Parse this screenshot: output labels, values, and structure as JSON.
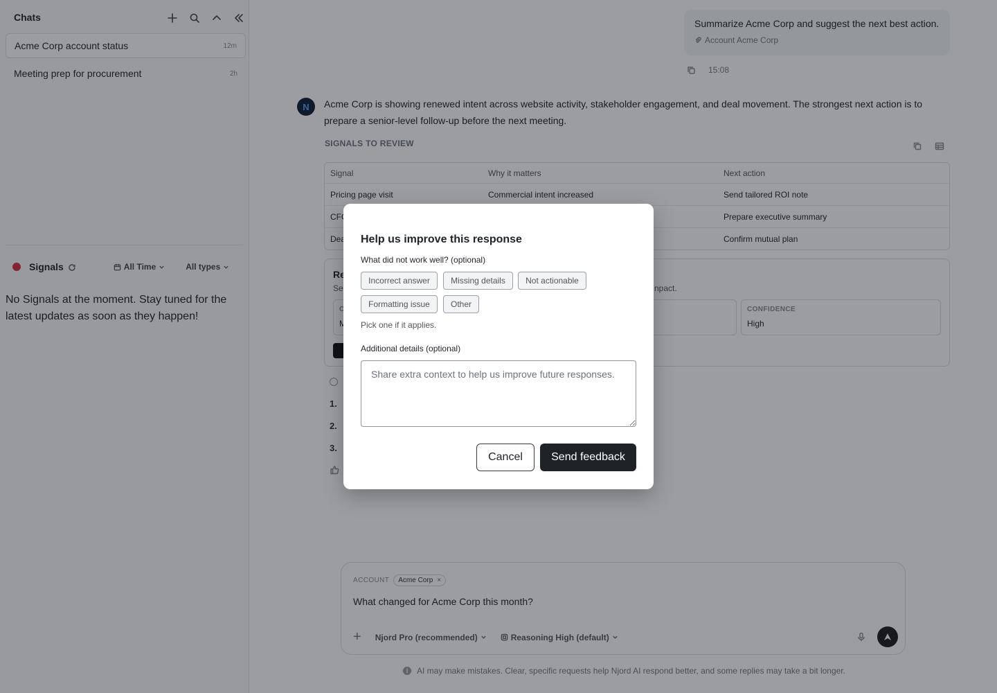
{
  "sidebar": {
    "title": "Chats",
    "chats": [
      {
        "label": "Acme Corp account status",
        "time": "12m"
      },
      {
        "label": "Meeting prep for procurement",
        "time": "2h"
      }
    ],
    "signals": {
      "title": "Signals",
      "filter_time": "All Time",
      "filter_types": "All types",
      "empty_message": "No Signals at the moment. Stay tuned for the latest updates as soon as they happen!"
    }
  },
  "conversation": {
    "user_message": "Summarize Acme Corp and suggest the next best action.",
    "user_attachment": "Account Acme Corp",
    "user_time": "15:08",
    "assistant_avatar": "N",
    "assistant_text": "Acme Corp is showing renewed intent across website activity, stakeholder engagement, and deal movement. The strongest next action is to prepare a senior-level follow-up before the next meeting.",
    "section_label": "SIGNALS TO REVIEW",
    "table": {
      "headers": [
        "Signal",
        "Why it matters",
        "Next action"
      ],
      "rows": [
        [
          "Pricing page visit",
          "Commercial intent increased",
          "Send tailored ROI note"
        ],
        [
          "CFO",
          "",
          "Prepare executive summary"
        ],
        [
          "Dea",
          "",
          "Confirm mutual plan"
        ]
      ]
    },
    "recommendation": {
      "title": "Re",
      "subtitle_start": "Se",
      "subtitle_end": "npact.",
      "box1_key": "C",
      "box1_val": "M",
      "confidence_key": "CONFIDENCE",
      "confidence_val": "High"
    },
    "steps": [
      "1.",
      "2.",
      "3."
    ]
  },
  "composer": {
    "account_label": "ACCOUNT",
    "account_chip": "Acme Corp",
    "input_value": "What changed for Acme Corp this month?",
    "model": "Njord Pro (recommended)",
    "reasoning": "Reasoning High (default)",
    "disclaimer": "AI may make mistakes. Clear, specific requests help Njord AI respond better, and some replies may take a bit longer."
  },
  "modal": {
    "title": "Help us improve this response",
    "question": "What did not work well? (optional)",
    "chips": [
      "Incorrect answer",
      "Missing details",
      "Not actionable",
      "Formatting issue",
      "Other"
    ],
    "hint": "Pick one if it applies.",
    "details_label": "Additional details (optional)",
    "details_placeholder": "Share extra context to help us improve future responses.",
    "cancel_label": "Cancel",
    "send_label": "Send feedback"
  },
  "colors": {
    "signal_dot": "#d92d3a",
    "primary_button": "#1f2328",
    "overlay": "rgba(16,22,32,0.42)"
  }
}
